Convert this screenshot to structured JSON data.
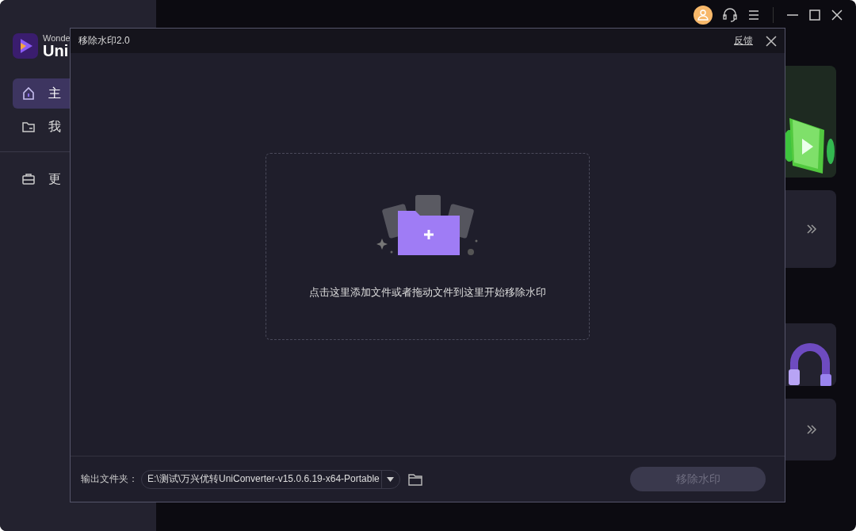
{
  "app": {
    "logo": {
      "line1": "Wonde",
      "line2": "Uni"
    },
    "sidebar": {
      "groups": [
        [
          {
            "label": "主",
            "selected": true
          },
          {
            "label": "我",
            "selected": false
          }
        ],
        [
          {
            "label": "更",
            "selected": false
          }
        ]
      ]
    },
    "cards": [
      {
        "kind": "picture"
      },
      {
        "kind": "more"
      },
      {
        "kind": "picture"
      },
      {
        "kind": "more"
      }
    ]
  },
  "dialog": {
    "title": "移除水印2.0",
    "feedback": "反馈",
    "drop_hint": "点击这里添加文件或者拖动文件到这里开始移除水印",
    "output": {
      "label": "输出文件夹：",
      "value": "E:\\测试\\万兴优转UniConverter-v15.0.6.19-x64-Portable"
    },
    "remove_button": {
      "label": "移除水印",
      "disabled": true
    }
  }
}
